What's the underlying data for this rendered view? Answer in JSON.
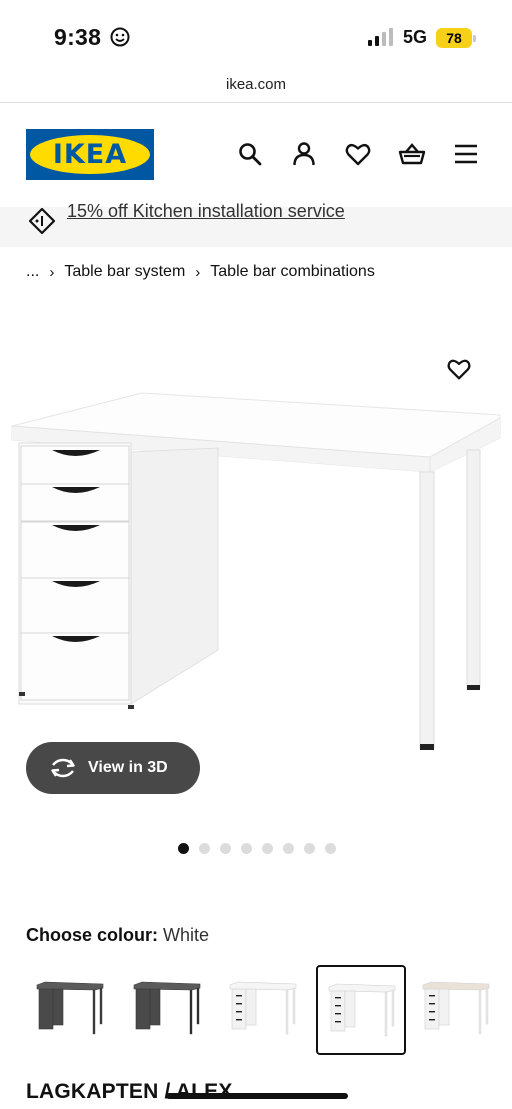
{
  "status_bar": {
    "time": "9:38",
    "network": "5G",
    "battery": "78"
  },
  "browser": {
    "url": "ikea.com"
  },
  "header": {
    "logo_text": "IKEA",
    "icons": [
      "search-icon",
      "profile-icon",
      "heart-icon",
      "basket-icon",
      "menu-icon"
    ]
  },
  "promo": {
    "text": "15% off Kitchen installation service"
  },
  "breadcrumb": {
    "ellipsis": "...",
    "items": [
      "Table bar system",
      "Table bar combinations"
    ]
  },
  "gallery": {
    "view_3d_label": "View in 3D",
    "dot_count": 8,
    "active_dot": 0
  },
  "colour": {
    "label": "Choose colour:",
    "value": "White",
    "swatches": [
      {
        "top": "#5b5b5b",
        "drawers": "#4a4a4a",
        "legs": "#3a3a3a"
      },
      {
        "top": "#5b5b5b",
        "drawers": "#4a4a4a",
        "legs": "#2a2a2a"
      },
      {
        "top": "#f5f5f5",
        "drawers": "#f2f2f2",
        "legs": "#e8e8e8"
      },
      {
        "top": "#f5f5f5",
        "drawers": "#f2f2f2",
        "legs": "#e8e8e8"
      },
      {
        "top": "#eae2d7",
        "drawers": "#f2f2f2",
        "legs": "#e8e8e8"
      }
    ],
    "selected_index": 3
  },
  "product": {
    "title": "LAGKAPTEN / ALEX"
  },
  "colors": {
    "ikea_blue": "#0058a3",
    "ikea_yellow": "#ffdb00",
    "battery_yellow": "#f7d117"
  }
}
